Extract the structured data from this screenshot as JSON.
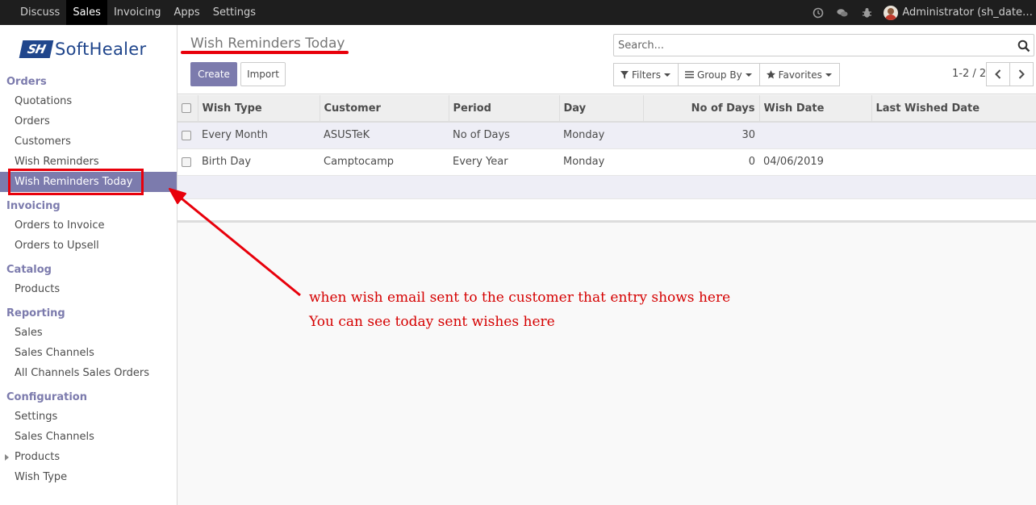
{
  "topbar": {
    "menu": [
      {
        "label": "Discuss",
        "active": false
      },
      {
        "label": "Sales",
        "active": true
      },
      {
        "label": "Invoicing",
        "active": false
      },
      {
        "label": "Apps",
        "active": false
      },
      {
        "label": "Settings",
        "active": false
      }
    ],
    "icons": [
      "clock-icon",
      "chat-icon",
      "bug-icon"
    ],
    "user": "Administrator (sh_date…"
  },
  "sidebar": {
    "logo": {
      "mark": "SH",
      "name": "SoftHealer"
    },
    "sections": [
      {
        "title": "Orders",
        "items": [
          "Quotations",
          "Orders",
          "Customers",
          "Wish Reminders",
          "Wish Reminders Today"
        ]
      },
      {
        "title": "Invoicing",
        "items": [
          "Orders to Invoice",
          "Orders to Upsell"
        ]
      },
      {
        "title": "Catalog",
        "items": [
          "Products"
        ]
      },
      {
        "title": "Reporting",
        "items": [
          "Sales",
          "Sales Channels",
          "All Channels Sales Orders"
        ]
      },
      {
        "title": "Configuration",
        "items": [
          "Settings",
          "Sales Channels",
          "Products",
          "Wish Type"
        ]
      }
    ],
    "active_item": "Wish Reminders Today"
  },
  "control_panel": {
    "title": "Wish Reminders Today",
    "create_label": "Create",
    "import_label": "Import",
    "search_placeholder": "Search...",
    "filters_label": "Filters",
    "groupby_label": "Group By",
    "favorites_label": "Favorites",
    "pager": "1-2 / 2"
  },
  "table": {
    "columns": [
      "Wish Type",
      "Customer",
      "Period",
      "Day",
      "No of Days",
      "Wish Date",
      "Last Wished Date"
    ],
    "rows": [
      {
        "wish_type": "Every Month",
        "customer": "ASUSTeK",
        "period": "No of Days",
        "day": "Monday",
        "no_of_days": "30",
        "wish_date": "",
        "last_wished_date": ""
      },
      {
        "wish_type": "Birth Day",
        "customer": "Camptocamp",
        "period": "Every Year",
        "day": "Monday",
        "no_of_days": "0",
        "wish_date": "04/06/2019",
        "last_wished_date": ""
      }
    ]
  },
  "annotation": {
    "line1": "when wish email sent to the customer that entry shows here",
    "line2": "You can see today sent wishes here",
    "color": "#d50000"
  },
  "colors": {
    "brand": "#7c7bad",
    "highlight": "#e8000b",
    "logo": "#20468c"
  }
}
